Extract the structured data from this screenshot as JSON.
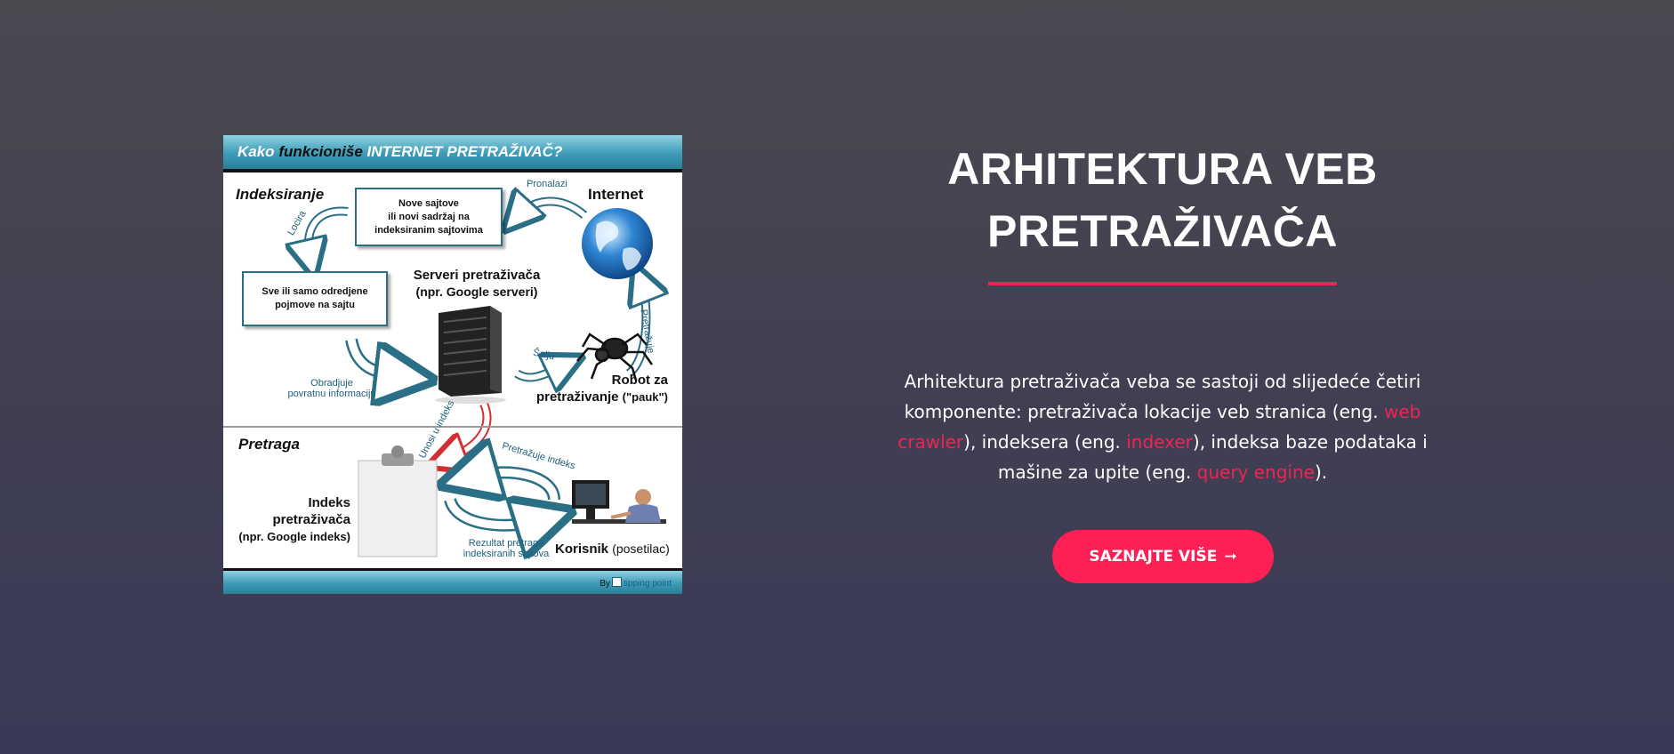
{
  "figure": {
    "title_part1": "Kako",
    "title_part2": "funkcioniše",
    "title_part3": "INTERNET PRETRAŽIVAČ?",
    "section_indexing": "Indeksiranje",
    "box_new_sites_line1": "Nove sajtove",
    "box_new_sites_line2": "ili novi sadržaj na",
    "box_new_sites_line3": "indeksiranim sajtovima",
    "label_found": "Pronalazi",
    "label_internet": "Internet",
    "label_locate": "Locira",
    "box_terms_line1": "Sve ili samo odredjene",
    "box_terms_line2": "pojmove na sajtu",
    "servers_line1": "Serveri pretraživača",
    "servers_line2": "(npr. Google serveri)",
    "label_crawls": "Pretražuje",
    "label_sends": "Šalju",
    "label_process_line1": "Obradjuje",
    "label_process_line2": "povratnu informaciju",
    "robot_line1": "Robot za",
    "robot_line2": "pretraživanje",
    "robot_line3": "(\"pauk\")",
    "section_search": "Pretraga",
    "label_enter_index": "Unosi u indeks",
    "label_search_index": "Pretražuje indeks",
    "index_line1": "Indeks",
    "index_line2": "pretraživača",
    "index_line3": "(npr. Google indeks)",
    "result_line1": "Rezultat pretrage",
    "result_line2": "indeksiranih sajtova",
    "user_label": "Korisnik",
    "user_sub": "(posetilac)",
    "credit_by": "By",
    "credit_brand": "tipping point"
  },
  "heading": {
    "line1": "ARHITEKTURA VEB",
    "line2": "PRETRAŽIVAČA"
  },
  "description": {
    "part1": "Arhitektura pretraživača veba se sastoji od slijedeće četiri komponente: pretraživača lokacije veb stranica (eng. ",
    "highlight1": "web crawler",
    "part2": "), indeksera (eng. ",
    "highlight2": "indexer",
    "part3": "), indeksa baze podataka i mašine za upite (eng. ",
    "highlight3": "query engine",
    "part4": ")."
  },
  "cta": {
    "label": "SAZNAJTE VIŠE",
    "arrow": "➞"
  },
  "colors": {
    "accent": "#fe1f55",
    "highlight": "#f02454",
    "teal": "#2b6f86"
  },
  "icons": [
    "globe-icon",
    "server-icon",
    "spider-icon",
    "clipboard-icon",
    "computer-user-icon",
    "arrow-right-icon"
  ]
}
